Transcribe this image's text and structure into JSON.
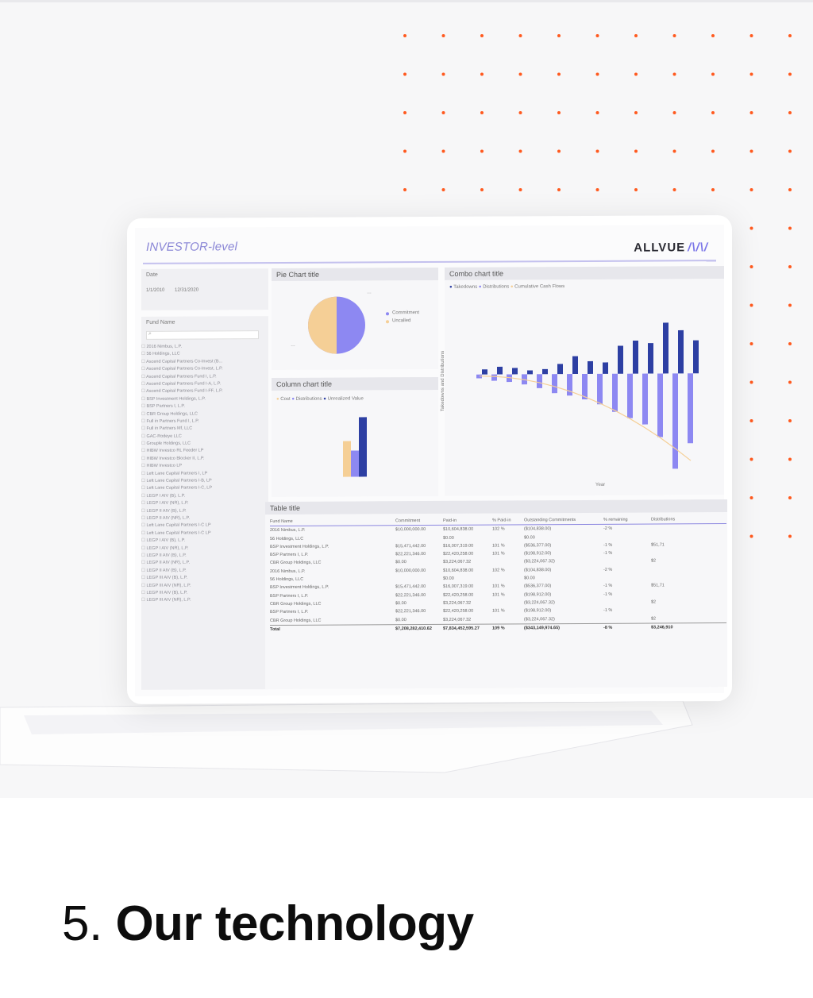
{
  "colors": {
    "accent_orange": "#ff5a1f",
    "purple": "#8d88f2",
    "navy": "#2d3fa3",
    "tan": "#f5cf96"
  },
  "dashboard": {
    "title": "INVESTOR-level",
    "logo_text": "ALLVUE",
    "logo_mark": "/\\/\\/",
    "date_label": "Date",
    "date_from": "1/1/2010",
    "date_to": "12/31/2020",
    "fund_label": "Fund Name",
    "search_icon": "search-icon",
    "funds": [
      "2016 Nimbus, L.P.",
      "56 Holdings, LLC",
      "Ascend Capital Partners Co-Invest (B...",
      "Ascend Capital Partners Co-Invest, L.P.",
      "Ascend Capital Partners Fund I, L.P.",
      "Ascend Capital Partners Fund I-A, L.P.",
      "Ascend Capital Partners Fund I-FF, L.P.",
      "BSP Investment Holdings, L.P.",
      "BSP Partners I, L.P.",
      "CBR Group Holdings, LLC",
      "Full in Partners Fund I, L.P.",
      "Full in Partners Mf, LLC",
      "GAC-Rodeye LLC",
      "Grouple Holdings, LLC",
      "HIBW Investco RL Feeder LP",
      "HIBW Investco Blocker II, L.P.",
      "HIBW Investco LP",
      "Left Lane Capital Partners I, LP",
      "Left Lane Capital Partners I-B, LP",
      "Left Lane Capital Partners I-C, LP",
      "LEGP I AIV (B), L.P.",
      "LEGP I AIV (NR), L.P.",
      "LEGP II AIV (B), L.P.",
      "LEGP II AIV (NR), L.P.",
      "Left Lane Capital Partners I-C LP",
      "Left Lane Capital Partners I-C LP",
      "LEGP I AIV (B), L.P.",
      "LEGP I AIV (NR), L.P.",
      "LEGP II AIV (B), L.P.",
      "LEGP II AIV (NR), L.P.",
      "LEGP II AIV (B), L.P.",
      "LEGP III AIV (B), L.P.",
      "LEGP III AIV (NR), L.P.",
      "LEGP III AIV (B), L.P.",
      "LEGP III AIV (NR), L.P."
    ],
    "pie": {
      "title": "Pie Chart title",
      "legend": [
        "Commitment",
        "Uncalled"
      ],
      "labels": [
        "…",
        "…"
      ]
    },
    "column": {
      "title": "Column chart title",
      "legend": [
        "Cost",
        "Distributions",
        "Unrealized Value"
      ]
    },
    "combo": {
      "title": "Combo chart title",
      "legend": [
        "Takedowns",
        "Distributions",
        "Cumulative Cash Flows"
      ],
      "ylabel": "Takedowns and Distributions",
      "xlabel": "Year"
    },
    "table": {
      "title": "Table title",
      "columns": [
        "Fund Name",
        "Commitment",
        "Paid-in",
        "% Paid-in",
        "Outstanding Commitments",
        "% remaining",
        "Distributions"
      ],
      "rows": [
        [
          "2016 Nimbus, L.P.",
          "$10,000,000.00",
          "$10,604,838.00",
          "102 %",
          "($104,838.00)",
          "-2 %",
          ""
        ],
        [
          "56 Holdings, LLC",
          "",
          "$0.00",
          "",
          "$0.00",
          "",
          ""
        ],
        [
          "BSP Investment Holdings, L.P.",
          "$15,471,442.00",
          "$16,007,319.00",
          "101 %",
          "($536,377.00)",
          "-1 %",
          "$51,71"
        ],
        [
          "BSP Partners I, L.P.",
          "$22,221,346.00",
          "$22,420,258.00",
          "101 %",
          "($198,912.00)",
          "-1 %",
          ""
        ],
        [
          "CBR Group Holdings, LLC",
          "$0.00",
          "$3,224,067.32",
          "",
          "($3,224,067.32)",
          "",
          "$2"
        ],
        [
          "2016 Nimbus, L.P.",
          "$10,000,000.00",
          "$10,604,838.00",
          "102 %",
          "($104,838.00)",
          "-2 %",
          ""
        ],
        [
          "56 Holdings, LLC",
          "",
          "$0.00",
          "",
          "$0.00",
          "",
          ""
        ],
        [
          "BSP Investment Holdings, L.P.",
          "$15,471,442.00",
          "$16,007,319.00",
          "101 %",
          "($536,377.00)",
          "-1 %",
          "$51,71"
        ],
        [
          "BSP Partners I, L.P.",
          "$22,221,346.00",
          "$22,420,258.00",
          "101 %",
          "($198,912.00)",
          "-1 %",
          ""
        ],
        [
          "CBR Group Holdings, LLC",
          "$0.00",
          "$3,224,067.32",
          "",
          "($3,224,067.32)",
          "",
          "$2"
        ],
        [
          "BSP Partners I, L.P.",
          "$22,221,346.00",
          "$22,420,258.00",
          "101 %",
          "($198,912.00)",
          "-1 %",
          ""
        ],
        [
          "CBR Group Holdings, LLC",
          "$0.00",
          "$3,224,067.32",
          "",
          "($3,224,067.32)",
          "",
          "$2"
        ]
      ],
      "total": [
        "Total",
        "$7,208,282,410.62",
        "$7,834,452,595.27",
        "109 %",
        "($343,149,974.65)",
        "-8 %",
        "$3,246,910"
      ]
    }
  },
  "heading": {
    "number": "5.",
    "text": "Our technology"
  }
}
